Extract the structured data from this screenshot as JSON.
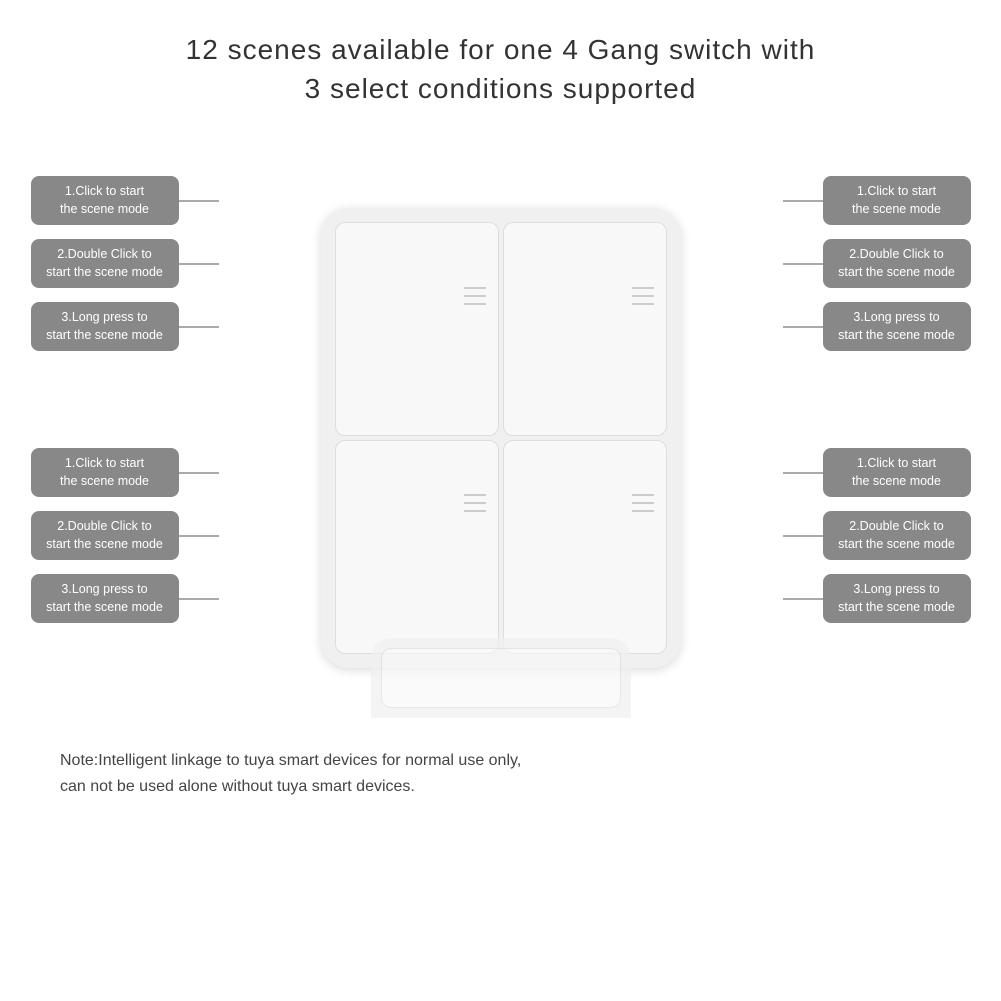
{
  "page": {
    "background": "#ffffff",
    "title_line1": "12 scenes available for one 4 Gang switch with",
    "title_line2": "3 select conditions supported",
    "note": "Note:Intelligent linkage to tuya smart devices for normal use only,\ncan not be used alone without tuya smart devices.",
    "left_top_labels": [
      "1.Click to start\nthe scene mode",
      "2.Double Click to\nstart the scene mode",
      "3.Long press to\nstart the scene mode"
    ],
    "left_bottom_labels": [
      "1.Click to start\nthe scene mode",
      "2.Double Click to\nstart the scene mode",
      "3.Long press to\nstart the scene mode"
    ],
    "right_top_labels": [
      "1.Click to start\nthe scene mode",
      "2.Double Click to\nstart the scene mode",
      "3.Long press to\nstart the scene mode"
    ],
    "right_bottom_labels": [
      "1.Click to start\nthe scene mode",
      "2.Double Click to\nstart the scene mode",
      "3.Long press to\nstart the scene mode"
    ]
  }
}
